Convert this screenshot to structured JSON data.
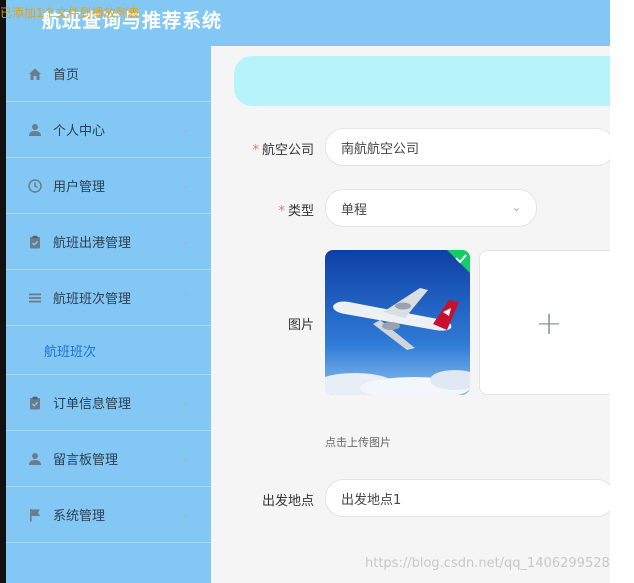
{
  "overlay": {
    "text": "已添加1个文件到播放列表"
  },
  "app": {
    "title": "航班查询与推荐系统"
  },
  "sidebar": {
    "items": [
      {
        "label": "首页",
        "icon": "home-icon"
      },
      {
        "label": "个人中心",
        "icon": "user-icon"
      },
      {
        "label": "用户管理",
        "icon": "clock-icon"
      },
      {
        "label": "航班出港管理",
        "icon": "clipboard-icon"
      },
      {
        "label": "航班班次管理",
        "icon": "list-icon"
      },
      {
        "label": "订单信息管理",
        "icon": "clipboard-icon"
      },
      {
        "label": "留言板管理",
        "icon": "user-icon"
      },
      {
        "label": "系统管理",
        "icon": "flag-icon"
      }
    ],
    "submenu": {
      "label": "航班班次"
    }
  },
  "form": {
    "airline": {
      "label": "航空公司",
      "value": "南航航空公司"
    },
    "type": {
      "label": "类型",
      "value": "单程"
    },
    "image": {
      "label": "图片",
      "hint": "点击上传图片"
    },
    "departure": {
      "label": "出发地点",
      "value": "出发地点1"
    }
  },
  "watermark": "https://blog.csdn.net/qq_1406299528",
  "colors": {
    "sidebar": "#83c8f5",
    "banner": "#b7f3fa",
    "active_link": "#1f6fd1",
    "required": "#f56c6c"
  }
}
